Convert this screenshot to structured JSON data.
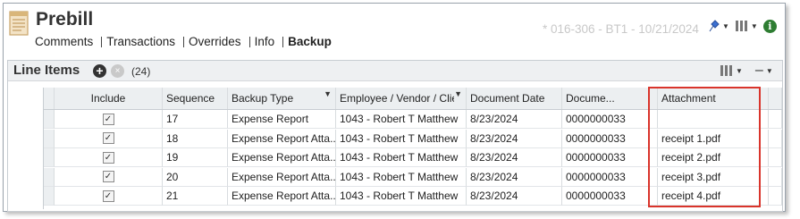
{
  "header": {
    "title": "Prebill",
    "doc_info": "* 016-306 - BT1 - 10/21/2024",
    "tabs": [
      {
        "label": "Comments",
        "active": false
      },
      {
        "label": "Transactions",
        "active": false
      },
      {
        "label": "Overrides",
        "active": false
      },
      {
        "label": "Info",
        "active": false
      },
      {
        "label": "Backup",
        "active": true
      }
    ],
    "icons": [
      "document-icon",
      "pin-icon",
      "columns-icon",
      "info-icon"
    ],
    "info_glyph": "i"
  },
  "panel": {
    "title": "Line Items",
    "count": "(24)",
    "add_glyph": "+",
    "remove_glyph": "×",
    "collapse_glyph": "–",
    "icons": [
      "add-icon",
      "remove-icon",
      "columns-icon",
      "collapse-icon"
    ]
  },
  "grid": {
    "columns": [
      "Include",
      "Sequence",
      "Backup Type",
      "Employee / Vendor / Client",
      "Document Date",
      "Docume...",
      "Attachment"
    ],
    "filtered_columns": [
      "Backup Type",
      "Employee / Vendor / Client"
    ],
    "rows": [
      {
        "include": true,
        "sequence": "17",
        "backup_type": "Expense Report",
        "employee": "1043 - Robert T Matthew",
        "doc_date": "8/23/2024",
        "document": "0000000033",
        "attachment": ""
      },
      {
        "include": true,
        "sequence": "18",
        "backup_type": "Expense Report Atta...",
        "employee": "1043 - Robert T Matthew",
        "doc_date": "8/23/2024",
        "document": "0000000033",
        "attachment": "receipt 1.pdf"
      },
      {
        "include": true,
        "sequence": "19",
        "backup_type": "Expense Report Atta...",
        "employee": "1043 - Robert T Matthew",
        "doc_date": "8/23/2024",
        "document": "0000000033",
        "attachment": "receipt 2.pdf"
      },
      {
        "include": true,
        "sequence": "20",
        "backup_type": "Expense Report Atta...",
        "employee": "1043 - Robert T Matthew",
        "doc_date": "8/23/2024",
        "document": "0000000033",
        "attachment": "receipt 3.pdf"
      },
      {
        "include": true,
        "sequence": "21",
        "backup_type": "Expense Report Atta...",
        "employee": "1043 - Robert T Matthew",
        "doc_date": "8/23/2024",
        "document": "0000000033",
        "attachment": "receipt 4.pdf"
      }
    ]
  },
  "colors": {
    "highlight": "#d9342b",
    "info_green": "#2e7d32",
    "doc_info_gray": "#c8c8c8"
  }
}
